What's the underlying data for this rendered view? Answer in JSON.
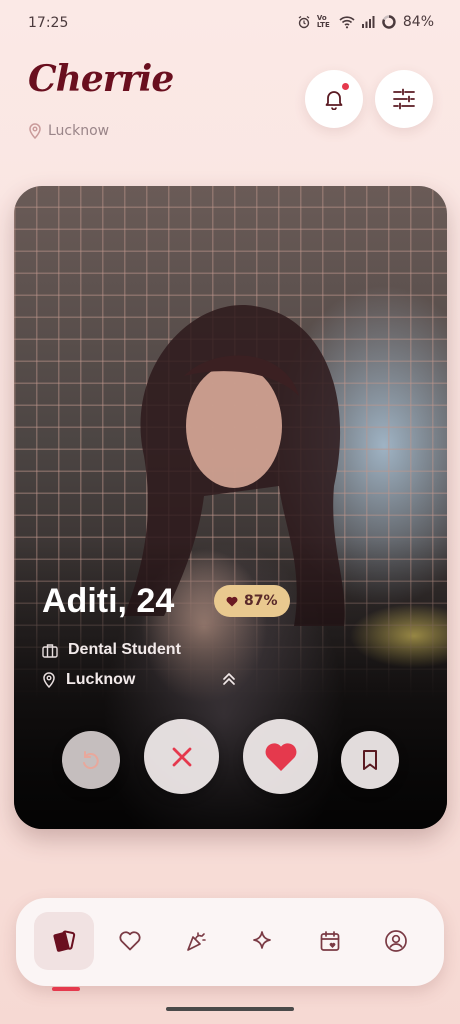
{
  "status_bar": {
    "time": "17:25",
    "network_label": "Vo LTE",
    "battery": "84%"
  },
  "header": {
    "app_name": "Cherrie",
    "location": "Lucknow",
    "icons": {
      "location": "location-pin-icon",
      "notifications": "bell-icon",
      "filters": "sliders-icon"
    },
    "has_unread_notifications": true
  },
  "profile": {
    "name_age": "Aditi, 24",
    "match_percent": "87%",
    "occupation": "Dental Student",
    "location": "Lucknow"
  },
  "actions": [
    {
      "name": "undo",
      "icon": "undo-icon"
    },
    {
      "name": "reject",
      "icon": "close-icon"
    },
    {
      "name": "like",
      "icon": "heart-icon"
    },
    {
      "name": "save",
      "icon": "bookmark-icon"
    }
  ],
  "bottom_nav": {
    "items": [
      {
        "name": "cards",
        "icon": "cards-icon",
        "active": true
      },
      {
        "name": "likes",
        "icon": "heart-outline-icon"
      },
      {
        "name": "matches",
        "icon": "party-popper-icon"
      },
      {
        "name": "discover",
        "icon": "sparkle-icon"
      },
      {
        "name": "dates",
        "icon": "calendar-heart-icon"
      },
      {
        "name": "profile",
        "icon": "user-circle-icon"
      }
    ]
  },
  "colors": {
    "brand": "#6a0f1f",
    "accent": "#e5394d",
    "badge": "#e9c98f",
    "background": "#fbe9e6"
  }
}
